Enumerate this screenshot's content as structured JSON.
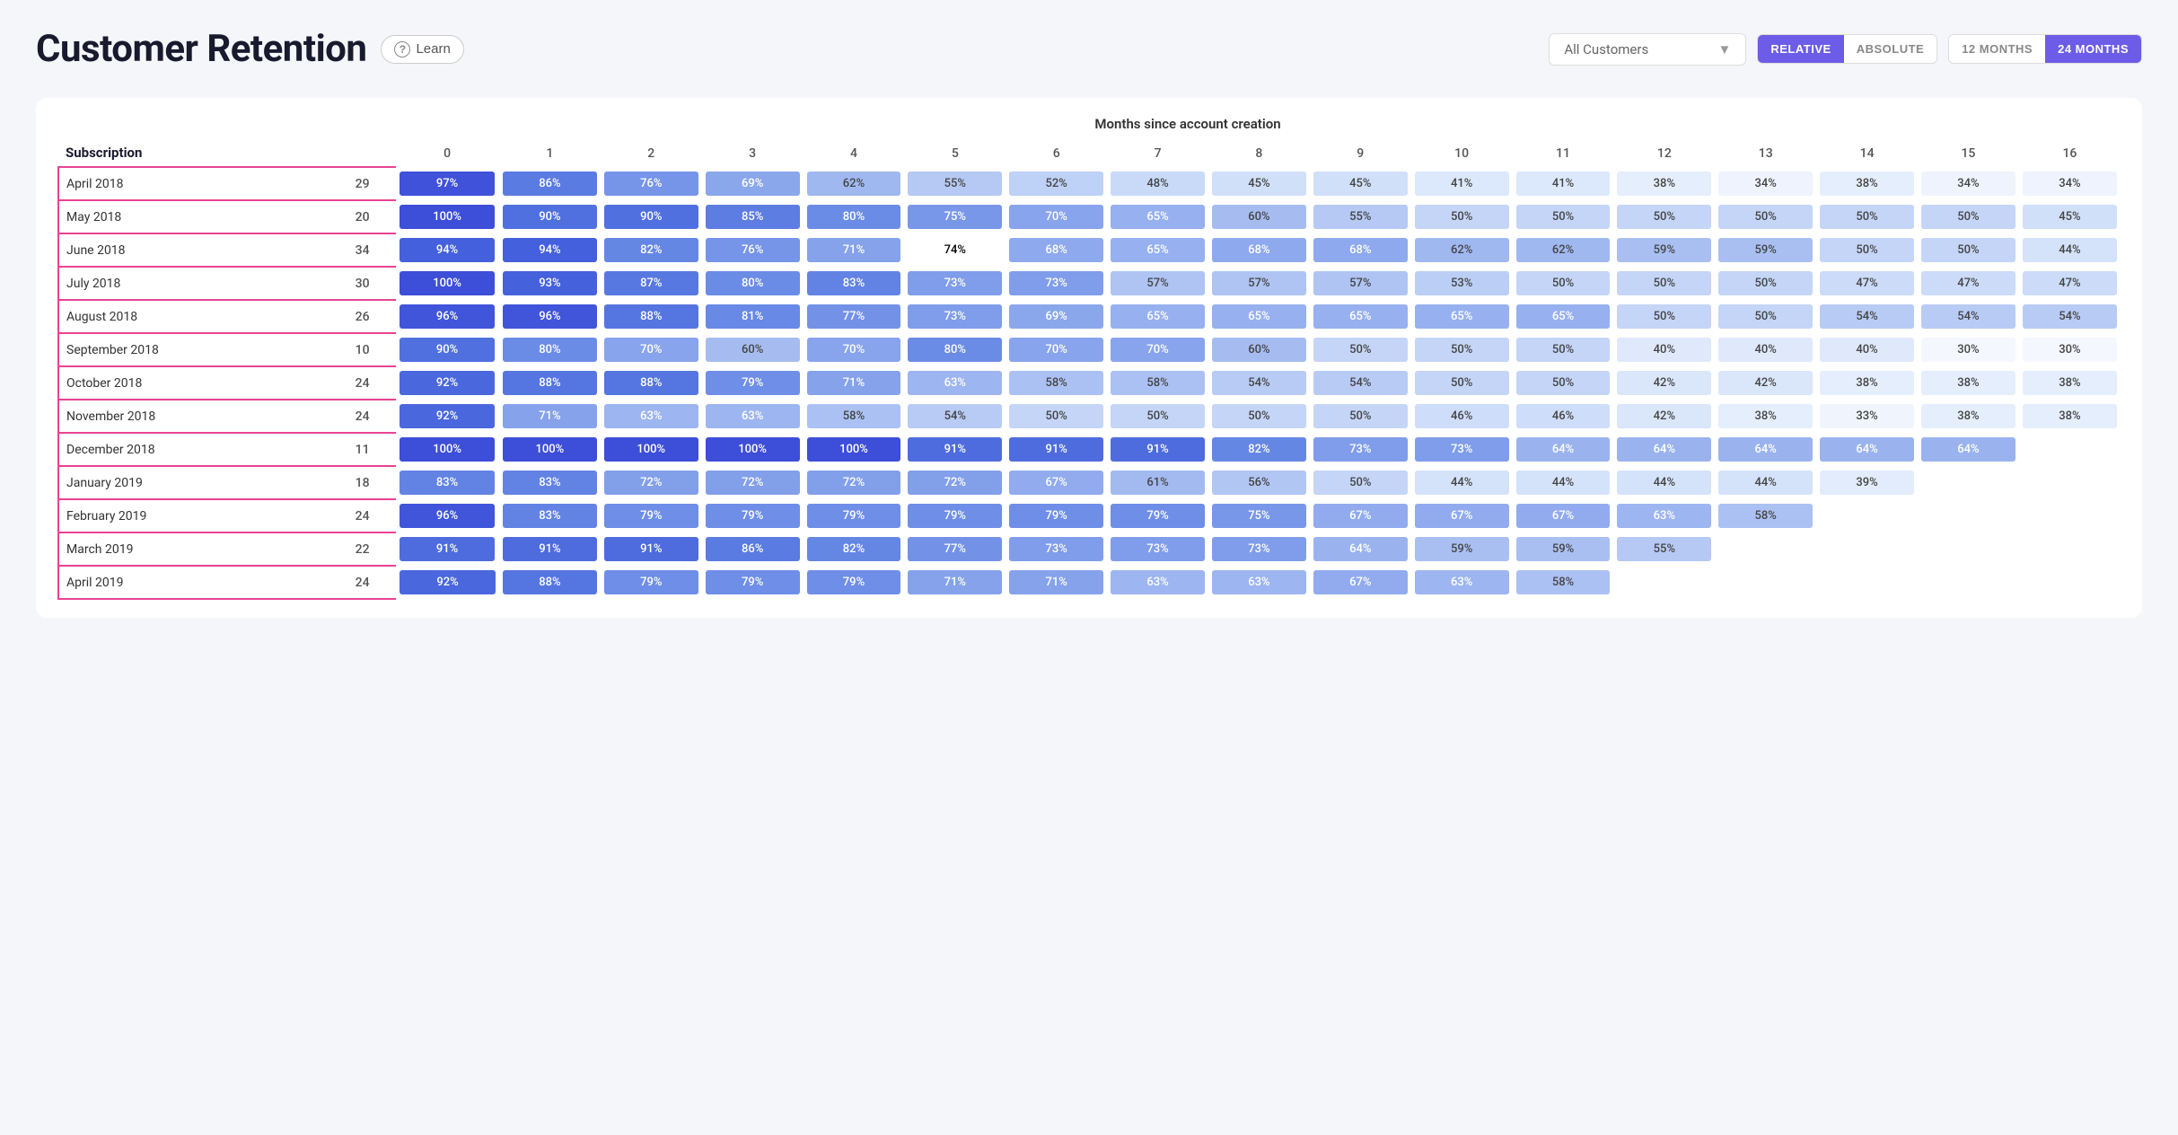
{
  "header": {
    "title": "Customer Retention",
    "learn_label": "Learn",
    "customer_dropdown": "All Customers",
    "toggle_relative": "RELATIVE",
    "toggle_absolute": "ABSOLUTE",
    "toggle_12months": "12 MONTHS",
    "toggle_24months": "24 MONTHS"
  },
  "table": {
    "section_header": "Months since account creation",
    "col_subscription": "Subscription",
    "months": [
      "0",
      "1",
      "2",
      "3",
      "4",
      "5",
      "6",
      "7",
      "8",
      "9",
      "10",
      "11",
      "12",
      "13",
      "14",
      "15",
      "16"
    ],
    "rows": [
      {
        "label": "April 2018",
        "count": 29,
        "highlighted": true,
        "values": [
          "97%",
          "86%",
          "76%",
          "69%",
          "62%",
          "55%",
          "52%",
          "48%",
          "45%",
          "45%",
          "41%",
          "41%",
          "38%",
          "34%",
          "38%",
          "34%",
          "34%"
        ],
        "classes": [
          "c-97",
          "c-86",
          "c-76",
          "c-69",
          "c-62",
          "c-55",
          "c-52",
          "c-48",
          "c-45",
          "c-45",
          "c-41",
          "c-41",
          "c-38",
          "c-34",
          "c-38",
          "c-34",
          "c-34"
        ]
      },
      {
        "label": "May 2018",
        "count": 20,
        "highlighted": true,
        "values": [
          "100%",
          "90%",
          "90%",
          "85%",
          "80%",
          "75%",
          "70%",
          "65%",
          "60%",
          "55%",
          "50%",
          "50%",
          "50%",
          "50%",
          "50%",
          "50%",
          "45%"
        ],
        "classes": [
          "c-100",
          "c-90",
          "c-90",
          "c-85",
          "c-80",
          "c-75",
          "c-70",
          "c-65",
          "c-60",
          "c-55",
          "c-50",
          "c-50",
          "c-50",
          "c-50",
          "c-50",
          "c-50",
          "c-45"
        ]
      },
      {
        "label": "June 2018",
        "count": 34,
        "highlighted": true,
        "values": [
          "94%",
          "94%",
          "82%",
          "76%",
          "71%",
          "74%",
          "68%",
          "65%",
          "68%",
          "68%",
          "62%",
          "62%",
          "59%",
          "59%",
          "50%",
          "50%",
          "44%"
        ],
        "classes": [
          "c-94",
          "c-94",
          "c-82",
          "c-76",
          "c-71",
          "c-74",
          "c-68",
          "c-65",
          "c-68",
          "c-68",
          "c-62",
          "c-62",
          "c-59",
          "c-59",
          "c-50",
          "c-50",
          "c-44"
        ]
      },
      {
        "label": "July 2018",
        "count": 30,
        "highlighted": true,
        "values": [
          "100%",
          "93%",
          "87%",
          "80%",
          "83%",
          "73%",
          "73%",
          "57%",
          "57%",
          "57%",
          "53%",
          "50%",
          "50%",
          "50%",
          "47%",
          "47%",
          "47%"
        ],
        "classes": [
          "c-100",
          "c-93",
          "c-87",
          "c-80",
          "c-83",
          "c-73",
          "c-73",
          "c-57",
          "c-57",
          "c-57",
          "c-53",
          "c-50",
          "c-50",
          "c-50",
          "c-47",
          "c-47",
          "c-47"
        ]
      },
      {
        "label": "August 2018",
        "count": 26,
        "highlighted": true,
        "values": [
          "96%",
          "96%",
          "88%",
          "81%",
          "77%",
          "73%",
          "69%",
          "65%",
          "65%",
          "65%",
          "65%",
          "65%",
          "50%",
          "50%",
          "54%",
          "54%",
          "54%"
        ],
        "classes": [
          "c-96",
          "c-96",
          "c-88",
          "c-81",
          "c-77",
          "c-73",
          "c-69",
          "c-65",
          "c-65",
          "c-65",
          "c-65",
          "c-65",
          "c-50",
          "c-50",
          "c-54",
          "c-54",
          "c-54"
        ]
      },
      {
        "label": "September 2018",
        "count": 10,
        "highlighted": true,
        "values": [
          "90%",
          "80%",
          "70%",
          "60%",
          "70%",
          "80%",
          "70%",
          "70%",
          "60%",
          "50%",
          "50%",
          "50%",
          "40%",
          "40%",
          "40%",
          "30%",
          "30%"
        ],
        "classes": [
          "c-90",
          "c-80",
          "c-70",
          "c-60",
          "c-70",
          "c-80",
          "c-70",
          "c-70",
          "c-60",
          "c-50",
          "c-50",
          "c-50",
          "c-40",
          "c-40",
          "c-40",
          "c-30",
          "c-30"
        ]
      },
      {
        "label": "October 2018",
        "count": 24,
        "highlighted": true,
        "values": [
          "92%",
          "88%",
          "88%",
          "79%",
          "71%",
          "63%",
          "58%",
          "58%",
          "54%",
          "54%",
          "50%",
          "50%",
          "42%",
          "42%",
          "38%",
          "38%",
          "38%"
        ],
        "classes": [
          "c-92",
          "c-88",
          "c-88",
          "c-79",
          "c-71",
          "c-63",
          "c-58",
          "c-58",
          "c-54",
          "c-54",
          "c-50",
          "c-50",
          "c-42",
          "c-42",
          "c-38",
          "c-38",
          "c-38"
        ]
      },
      {
        "label": "November 2018",
        "count": 24,
        "highlighted": true,
        "values": [
          "92%",
          "71%",
          "63%",
          "63%",
          "58%",
          "54%",
          "50%",
          "50%",
          "50%",
          "50%",
          "46%",
          "46%",
          "42%",
          "38%",
          "33%",
          "38%",
          "38%"
        ],
        "classes": [
          "c-92",
          "c-71",
          "c-63",
          "c-63",
          "c-58",
          "c-54",
          "c-50",
          "c-50",
          "c-50",
          "c-50",
          "c-46",
          "c-46",
          "c-42",
          "c-38",
          "c-33",
          "c-38",
          "c-38"
        ]
      },
      {
        "label": "December 2018",
        "count": 11,
        "highlighted": true,
        "values": [
          "100%",
          "100%",
          "100%",
          "100%",
          "100%",
          "91%",
          "91%",
          "91%",
          "82%",
          "73%",
          "73%",
          "64%",
          "64%",
          "64%",
          "64%",
          "64%",
          ""
        ],
        "classes": [
          "c-100",
          "c-100",
          "c-100",
          "c-100",
          "c-100",
          "c-91",
          "c-91",
          "c-91",
          "c-82",
          "c-73",
          "c-73",
          "c-64",
          "c-64",
          "c-64",
          "c-64",
          "c-64",
          "c-empty"
        ]
      },
      {
        "label": "January 2019",
        "count": 18,
        "highlighted": true,
        "values": [
          "83%",
          "83%",
          "72%",
          "72%",
          "72%",
          "72%",
          "67%",
          "61%",
          "56%",
          "50%",
          "44%",
          "44%",
          "44%",
          "44%",
          "39%",
          "",
          ""
        ],
        "classes": [
          "c-83",
          "c-83",
          "c-72",
          "c-72",
          "c-72",
          "c-72",
          "c-67",
          "c-61",
          "c-56",
          "c-50",
          "c-44",
          "c-44",
          "c-44",
          "c-44",
          "c-39",
          "c-empty",
          "c-empty"
        ]
      },
      {
        "label": "February 2019",
        "count": 24,
        "highlighted": true,
        "values": [
          "96%",
          "83%",
          "79%",
          "79%",
          "79%",
          "79%",
          "79%",
          "79%",
          "75%",
          "67%",
          "67%",
          "67%",
          "63%",
          "58%",
          "",
          "",
          ""
        ],
        "classes": [
          "c-96",
          "c-83",
          "c-79",
          "c-79",
          "c-79",
          "c-79",
          "c-79",
          "c-79",
          "c-75",
          "c-67",
          "c-67",
          "c-67",
          "c-63",
          "c-58",
          "c-empty",
          "c-empty",
          "c-empty"
        ]
      },
      {
        "label": "March 2019",
        "count": 22,
        "highlighted": true,
        "values": [
          "91%",
          "91%",
          "91%",
          "86%",
          "82%",
          "77%",
          "73%",
          "73%",
          "73%",
          "64%",
          "59%",
          "59%",
          "55%",
          "",
          "",
          "",
          ""
        ],
        "classes": [
          "c-91",
          "c-91",
          "c-91",
          "c-86",
          "c-82",
          "c-77",
          "c-73",
          "c-73",
          "c-73",
          "c-64",
          "c-59",
          "c-59",
          "c-55",
          "c-empty",
          "c-empty",
          "c-empty",
          "c-empty"
        ]
      },
      {
        "label": "April 2019",
        "count": 24,
        "highlighted": true,
        "values": [
          "92%",
          "88%",
          "79%",
          "79%",
          "79%",
          "71%",
          "71%",
          "63%",
          "63%",
          "67%",
          "63%",
          "58%",
          "",
          "",
          "",
          "",
          ""
        ],
        "classes": [
          "c-92",
          "c-88",
          "c-79",
          "c-79",
          "c-79",
          "c-71",
          "c-71",
          "c-63",
          "c-63",
          "c-67",
          "c-63",
          "c-58",
          "c-empty",
          "c-empty",
          "c-empty",
          "c-empty",
          "c-empty"
        ]
      }
    ]
  }
}
